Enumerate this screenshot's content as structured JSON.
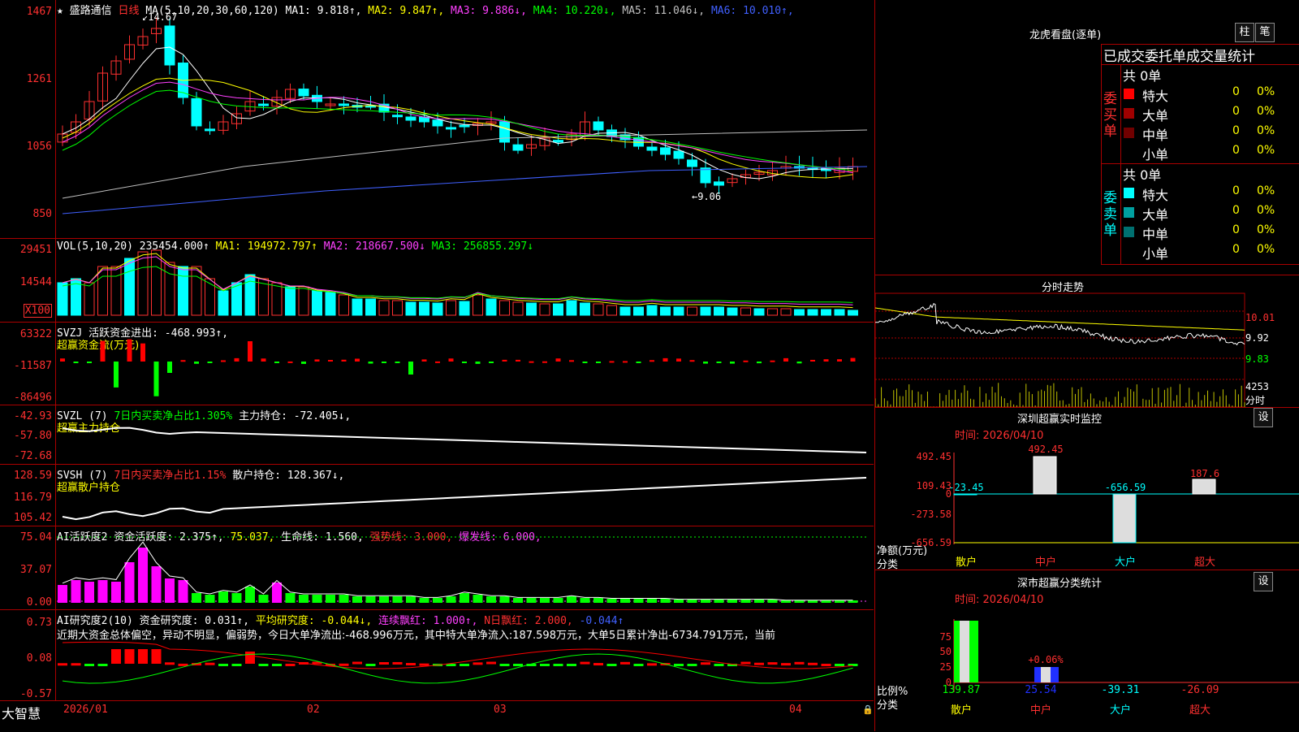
{
  "stock": {
    "star_icon": "★",
    "name": "盛路通信",
    "period": "日线",
    "ma_params": "MA(5,10,20,30,60,120)",
    "ma_values": [
      {
        "label": "MA1:",
        "value": "9.818↑",
        "color": "#ffffff"
      },
      {
        "label": "MA2:",
        "value": "9.847↑",
        "color": "#ffff00"
      },
      {
        "label": "MA3:",
        "value": "9.886↓",
        "color": "#ff40ff"
      },
      {
        "label": "MA4:",
        "value": "10.220↓",
        "color": "#00ff00"
      },
      {
        "label": "MA5:",
        "value": "11.046↓",
        "color": "#c0c0c0"
      },
      {
        "label": "MA6:",
        "value": "10.010↑",
        "color": "#4060ff"
      }
    ],
    "price_ticks": [
      "1467",
      "1261",
      "1056",
      "850"
    ],
    "high_marker": "14.67",
    "low_marker": "9.06"
  },
  "vol": {
    "label": "VOL(5,10,20)",
    "value": "235454.000↑",
    "ma1": "MA1: 194972.797↑",
    "ma2": "MA2: 218667.500↓",
    "ma3": "MA3: 256855.297↓",
    "ticks": [
      "29451",
      "14544"
    ],
    "unit": "X100"
  },
  "svzj": {
    "label": "SVZJ  活跃资金进出: -468.993↑,",
    "sub": "超赢资金流(万元)",
    "ticks": [
      "63322",
      "-11587",
      "-86496"
    ]
  },
  "svzl": {
    "label": "SVZL (7)",
    "pct": "7日内买卖净占比1.305%",
    "main": "主力持仓: -72.405↓,",
    "sub": "超赢主力持仓",
    "ticks": [
      "-42.93",
      "-57.80",
      "-72.68"
    ]
  },
  "svsh": {
    "label": "SVSH (7)",
    "pct": "7日内买卖净占比1.15%",
    "main": "散户持仓: 128.367↓,",
    "sub": "超赢散户持仓",
    "ticks": [
      "128.59",
      "116.79",
      "105.42"
    ]
  },
  "ai1": {
    "label": "AI活跃度2",
    "a": "资金活跃度: 2.375↑,",
    "b": "75.037,",
    "c": "生命线: 1.560,",
    "d": "强势线: 3.000,",
    "e": "爆发线: 6.000,",
    "ticks": [
      "75.04",
      "37.07",
      "0.00"
    ]
  },
  "ai2": {
    "label": "AI研究度2(10)",
    "a": "资金研究度: 0.031↑,",
    "b": "平均研究度: -0.044↓,",
    "c": "连续飘红: 1.000↑,",
    "d": "N日飘红: 2.000,",
    "e": "-0.044↑",
    "comment": "近期大资金总体偏空，异动不明显，偏弱势，今日大单净流出:-468.996万元，其中特大单净流入:187.598万元，大单5日累计净出-6734.791万元，当前",
    "ticks": [
      "0.73",
      "0.08",
      "-0.57"
    ]
  },
  "bottom": {
    "brand": "大智慧",
    "dates": [
      "2026/01",
      "02",
      "03",
      "04"
    ]
  },
  "longhu": {
    "title": "龙虎看盘(逐单)",
    "btn1": "柱",
    "btn2": "笔",
    "subtitle": "已成交委托单成交量统计",
    "buy_label": "委买单",
    "sell_label": "委卖单",
    "buy_total": "共 0单",
    "sell_total": "共 0单",
    "buy_rows": [
      {
        "name": "特大",
        "v": "0",
        "p": "0%",
        "color": "#ff0000"
      },
      {
        "name": "大单",
        "v": "0",
        "p": "0%",
        "color": "#a00000"
      },
      {
        "name": "中单",
        "v": "0",
        "p": "0%",
        "color": "#700000"
      },
      {
        "name": "小单",
        "v": "0",
        "p": "0%",
        "color": ""
      }
    ],
    "sell_rows": [
      {
        "name": "特大",
        "v": "0",
        "p": "0%",
        "color": "#00ffff"
      },
      {
        "name": "大单",
        "v": "0",
        "p": "0%",
        "color": "#00a0a0"
      },
      {
        "name": "中单",
        "v": "0",
        "p": "0%",
        "color": "#007070"
      },
      {
        "name": "小单",
        "v": "0",
        "p": "0%",
        "color": ""
      }
    ]
  },
  "intraday": {
    "title": "分时走势",
    "ticks": [
      "10.01",
      "9.92",
      "9.83"
    ],
    "vol_tick": "4253",
    "vol_unit": "分时"
  },
  "sz_monitor": {
    "title": "深圳超赢实时监控",
    "set": "设",
    "time": "时间: 2026/04/10",
    "ticks": [
      "492.45",
      "109.43",
      "0",
      "-273.58",
      "-656.59"
    ],
    "ylabel": "净额(万元)",
    "xlabel": "分类",
    "cats": [
      "散户",
      "中户",
      "大户",
      "超大"
    ],
    "labels": [
      "-23.45",
      "492.45",
      "-656.59",
      "187.6"
    ]
  },
  "sz_class": {
    "title": "深市超赢分类统计",
    "set": "设",
    "time": "时间: 2026/04/10",
    "ticks": [
      "75",
      "50",
      "25",
      "0"
    ],
    "ylabel": "比例%",
    "xlabel": "分类",
    "cats": [
      "散户",
      "中户",
      "大户",
      "超大"
    ],
    "values": [
      "139.87",
      "25.54",
      "-39.31",
      "-26.09"
    ],
    "mid_label": "+0.06%"
  }
}
